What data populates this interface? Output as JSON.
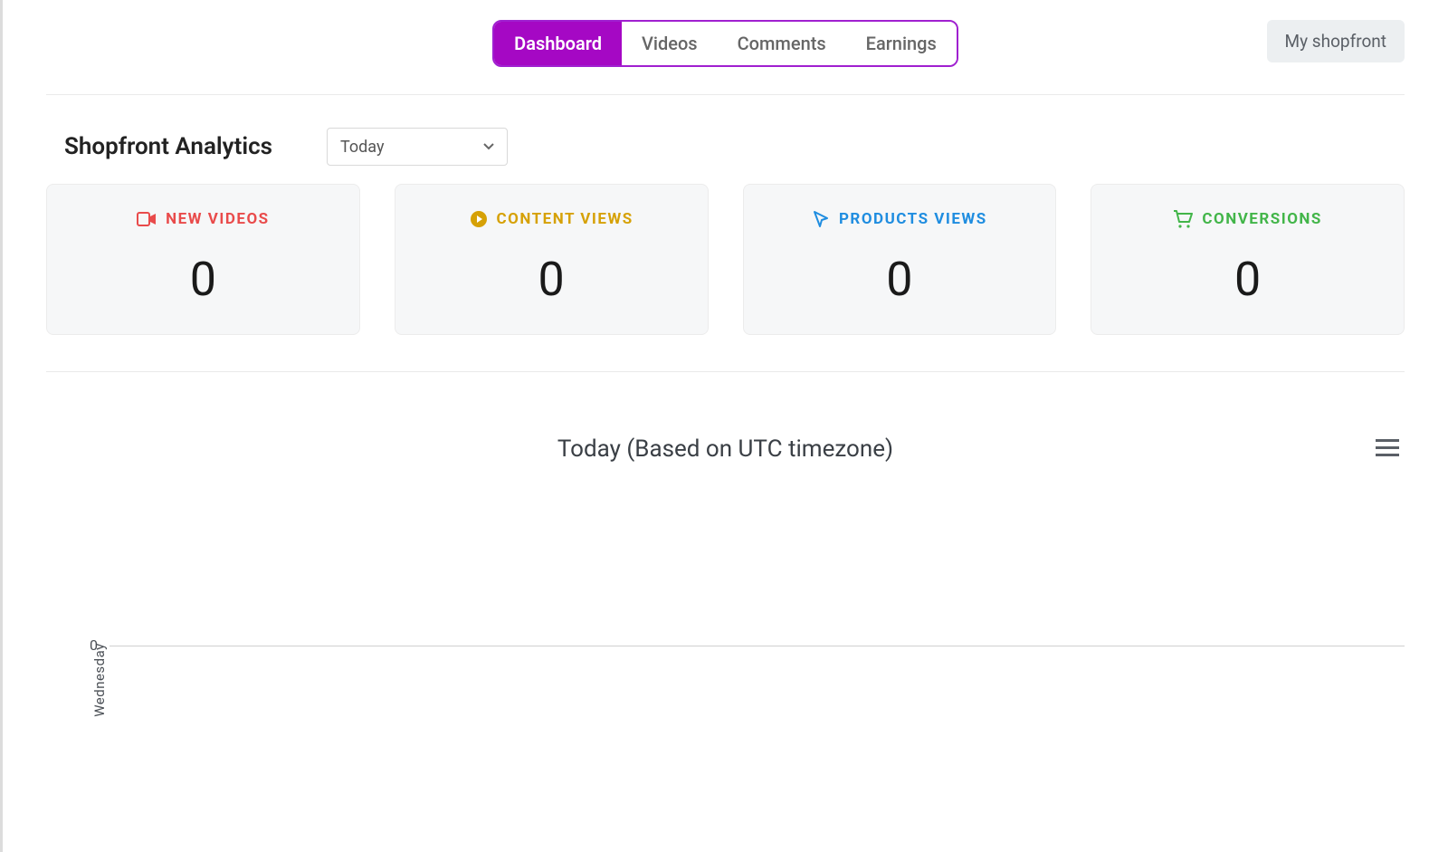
{
  "tabs": {
    "dashboard": "Dashboard",
    "videos": "Videos",
    "comments": "Comments",
    "earnings": "Earnings"
  },
  "shopfront_button": "My shopfront",
  "analytics": {
    "title": "Shopfront Analytics",
    "period_selected": "Today"
  },
  "cards": {
    "new_videos": {
      "label": "NEW VIDEOS",
      "value": "0"
    },
    "content_views": {
      "label": "CONTENT VIEWS",
      "value": "0"
    },
    "products_views": {
      "label": "PRODUCTS VIEWS",
      "value": "0"
    },
    "conversions": {
      "label": "CONVERSIONS",
      "value": "0"
    }
  },
  "chart": {
    "title": "Today (Based on UTC timezone)",
    "y_axis_label": "Wednesday",
    "y_tick": "0"
  },
  "chart_data": {
    "type": "line",
    "title": "Today (Based on UTC timezone)",
    "ylabel": "Wednesday",
    "categories": [],
    "series": [],
    "ylim": [
      0,
      0
    ],
    "y_ticks": [
      0
    ]
  }
}
